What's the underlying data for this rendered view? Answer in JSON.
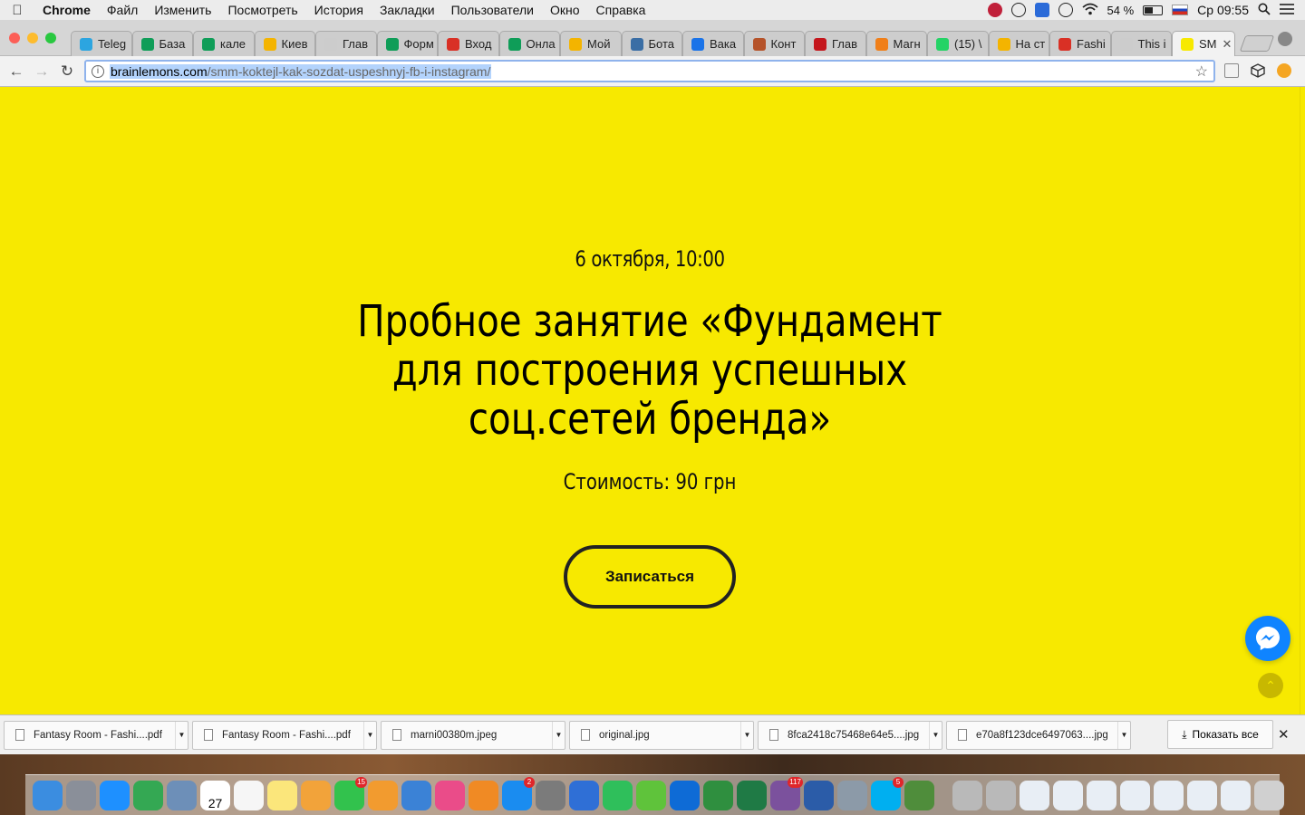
{
  "menubar": {
    "app_name": "Chrome",
    "items": [
      "Файл",
      "Изменить",
      "Посмотреть",
      "История",
      "Закладки",
      "Пользователи",
      "Окно",
      "Справка"
    ],
    "battery": "54 %",
    "clock": "Ср 09:55",
    "battery_level": 0.54
  },
  "tabs": [
    {
      "label": "Teleg",
      "color": "#2ca5e0"
    },
    {
      "label": "База",
      "color": "#0f9d58"
    },
    {
      "label": "кале",
      "color": "#0f9d58"
    },
    {
      "label": "Киев",
      "color": "#f4b400"
    },
    {
      "label": "Глав",
      "color": "#cccccc"
    },
    {
      "label": "Форм",
      "color": "#0f9d58"
    },
    {
      "label": "Вход",
      "color": "#d93025"
    },
    {
      "label": "Онла",
      "color": "#0f9d58"
    },
    {
      "label": "Мой",
      "color": "#f4b400"
    },
    {
      "label": "Бота",
      "color": "#3a6ea5"
    },
    {
      "label": "Вака",
      "color": "#1a73e8"
    },
    {
      "label": "Конт",
      "color": "#b5532a"
    },
    {
      "label": "Глав",
      "color": "#c4161c"
    },
    {
      "label": "Магн",
      "color": "#f07f19"
    },
    {
      "label": "(15) \\",
      "color": "#25d366"
    },
    {
      "label": "На ст",
      "color": "#f4b400"
    },
    {
      "label": "Fashi",
      "color": "#d93025"
    },
    {
      "label": "This i",
      "color": "#cccccc"
    },
    {
      "label": "SM",
      "color": "#f7e900"
    }
  ],
  "toolbar": {
    "url_host": "brainlemons.com",
    "url_path": "/smm-koktejl-kak-sozdat-uspeshnyj-fb-i-instagram/"
  },
  "page": {
    "date": "6 октября, 10:00",
    "title": "Пробное занятие «Фундамент для построения успешных соц.сетей бренда»",
    "price": "Стоимость: 90 грн",
    "cta_label": "Записаться",
    "bg_color": "#f7e900"
  },
  "downloads": {
    "items": [
      "Fantasy Room - Fashi....pdf",
      "Fantasy Room - Fashi....pdf",
      "marni00380m.jpeg",
      "original.jpg",
      "8fca2418c75468e64e5....jpg",
      "e70a8f123dce6497063....jpg"
    ],
    "show_all": "Показать все"
  },
  "dock": {
    "apps": [
      {
        "name": "finder-icon",
        "color": "#3b8de0"
      },
      {
        "name": "launchpad-icon",
        "color": "#8a8f99"
      },
      {
        "name": "safari-icon",
        "color": "#1e90ff"
      },
      {
        "name": "chrome-icon",
        "color": "#34a853"
      },
      {
        "name": "preview-icon",
        "color": "#6d8fb8"
      },
      {
        "name": "calendar-icon",
        "color": "#ffffff",
        "text": "27"
      },
      {
        "name": "reminders-icon",
        "color": "#f6f6f6"
      },
      {
        "name": "notes-icon",
        "color": "#fbe67b"
      },
      {
        "name": "photos-icon",
        "color": "#f2a33a"
      },
      {
        "name": "facetime-icon",
        "color": "#32c24d",
        "badge": "15"
      },
      {
        "name": "pages-icon",
        "color": "#f29b2f"
      },
      {
        "name": "keynote-icon",
        "color": "#3b82d6"
      },
      {
        "name": "itunes-icon",
        "color": "#ea4c89"
      },
      {
        "name": "ibooks-icon",
        "color": "#f08a24"
      },
      {
        "name": "appstore-icon",
        "color": "#1a8cf0",
        "badge": "2"
      },
      {
        "name": "system-preferences-icon",
        "color": "#7b7b7b"
      },
      {
        "name": "bluetooth-icon",
        "color": "#2f6fd6"
      },
      {
        "name": "numbers-icon",
        "color": "#2fbf5b"
      },
      {
        "name": "utorrent-icon",
        "color": "#5fc33b"
      },
      {
        "name": "teamviewer-icon",
        "color": "#0e6bd6"
      },
      {
        "name": "network-icon",
        "color": "#2f8f3f"
      },
      {
        "name": "excel-icon",
        "color": "#1f7a45"
      },
      {
        "name": "viber-icon",
        "color": "#7b519d",
        "badge": "117"
      },
      {
        "name": "word-icon",
        "color": "#2b5ca8"
      },
      {
        "name": "image-capture-icon",
        "color": "#8c9aa8"
      },
      {
        "name": "skype-icon",
        "color": "#00aff0",
        "badge": "5"
      },
      {
        "name": "camino-icon",
        "color": "#4f8d3b"
      }
    ],
    "trailing": [
      {
        "name": "unknown-app-icon",
        "color": "#b9b9b9"
      },
      {
        "name": "unknown-app-icon",
        "color": "#b9b9b9"
      },
      {
        "name": "document-stack-icon",
        "color": "#e8eef5"
      },
      {
        "name": "document-stack-icon",
        "color": "#e8eef5"
      },
      {
        "name": "document-stack-icon",
        "color": "#e8eef5"
      },
      {
        "name": "document-stack-icon",
        "color": "#e8eef5"
      },
      {
        "name": "document-stack-icon",
        "color": "#e8eef5"
      },
      {
        "name": "document-stack-icon",
        "color": "#e8eef5"
      },
      {
        "name": "document-stack-icon",
        "color": "#e8eef5"
      },
      {
        "name": "trash-icon",
        "color": "#d0d0d0"
      }
    ]
  }
}
